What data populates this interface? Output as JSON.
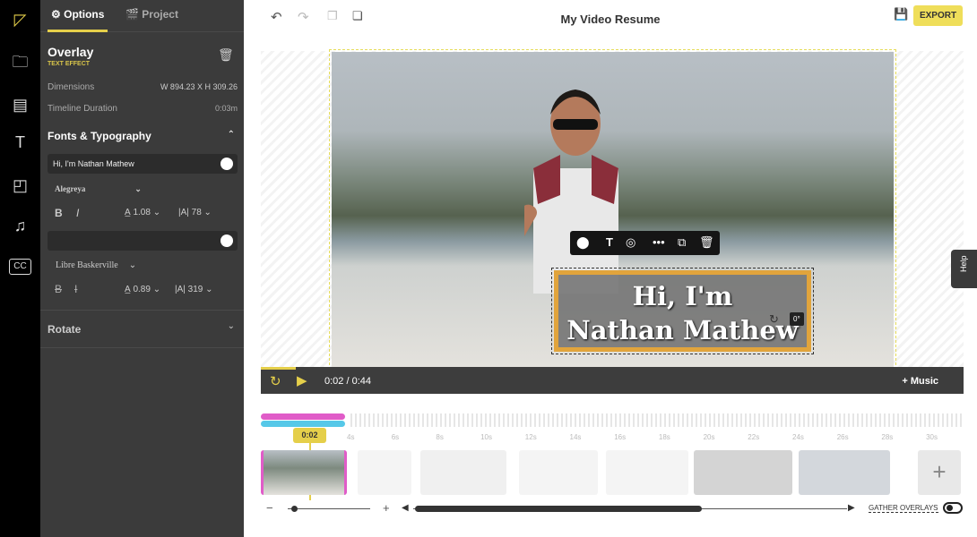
{
  "rail": {
    "icons": [
      "logo-icon",
      "upload-folder-icon",
      "media-library-icon",
      "text-icon",
      "shapes-icon",
      "music-icon",
      "captions-icon"
    ],
    "captions_label": "CC"
  },
  "panel": {
    "tabs": [
      {
        "label": "Options",
        "icon": "options-icon"
      },
      {
        "label": "Project",
        "icon": "clapper-icon"
      }
    ],
    "overlay_title": "Overlay",
    "overlay_type": "TEXT EFFECT",
    "dimensions_label": "Dimensions",
    "dimensions_value": "W 894.23 X H 309.26",
    "duration_label": "Timeline Duration",
    "duration_value": "0:03m",
    "fonts_heading": "Fonts & Typography",
    "text1": "Hi, I'm Nathan Mathew",
    "font1": "Alegreya",
    "line_height1": "1.08",
    "size1": "78",
    "text2": "",
    "font2": "Libre Baskerville",
    "line_height2": "0.89",
    "size2": "319",
    "rotate_heading": "Rotate"
  },
  "header": {
    "title": "My Video Resume",
    "export_label": "EXPORT"
  },
  "canvas": {
    "overlay_text_line1": "Hi, I'm",
    "overlay_text_line2": "Nathan Mathew",
    "rotation": "0°",
    "help_label": "Help"
  },
  "player": {
    "current": "0:02",
    "separator": "/",
    "total": "0:44",
    "music_label": "+ Music",
    "progress": 0.05
  },
  "timeline": {
    "playhead": "0:02",
    "ticks": [
      "4s",
      "6s",
      "8s",
      "10s",
      "12s",
      "14s",
      "16s",
      "18s",
      "20s",
      "22s",
      "24s",
      "26s",
      "28s",
      "30s"
    ],
    "gather_label": "GATHER OVERLAYS"
  },
  "colors": {
    "accent": "#e5cf4a",
    "overlay_border": "#e1a43c",
    "trim": "#e05cc8"
  }
}
